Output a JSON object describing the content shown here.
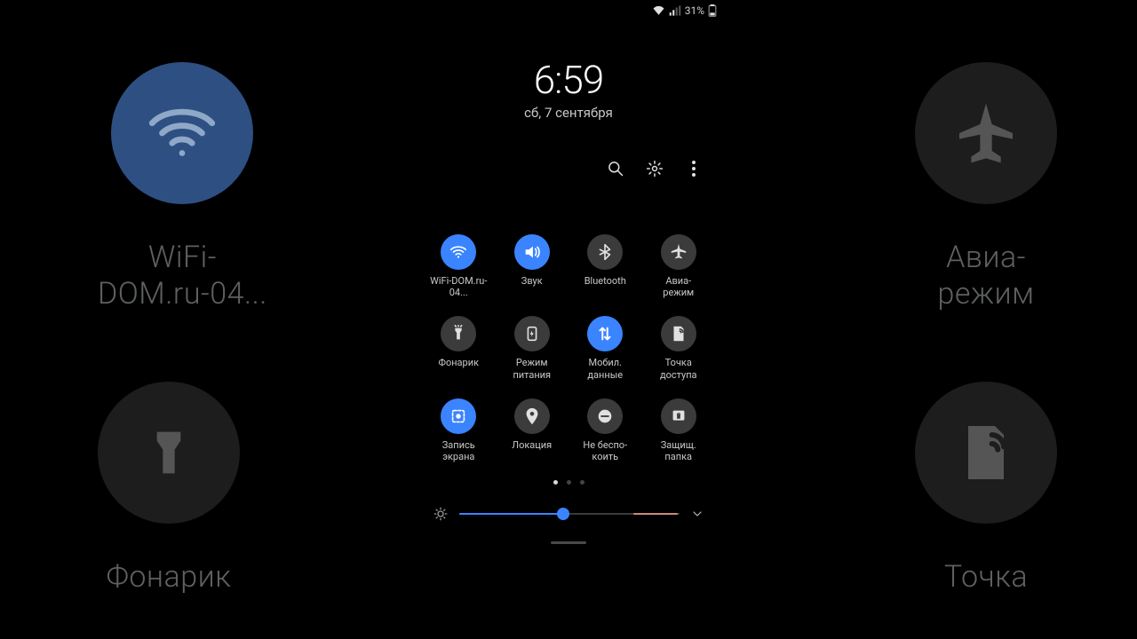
{
  "status": {
    "battery_pct": "31%"
  },
  "clock": {
    "time": "6:59",
    "date": "сб, 7 сентября"
  },
  "toggles": [
    {
      "id": "wifi",
      "label": "WiFi-DOM.ru-04...",
      "on": true
    },
    {
      "id": "sound",
      "label": "Звук",
      "on": true
    },
    {
      "id": "bluetooth",
      "label": "Bluetooth",
      "on": false
    },
    {
      "id": "airplane",
      "label": "Авиа-\nрежим",
      "on": false
    },
    {
      "id": "flashlight",
      "label": "Фонарик",
      "on": false
    },
    {
      "id": "power",
      "label": "Режим\nпитания",
      "on": false
    },
    {
      "id": "data",
      "label": "Мобил.\nданные",
      "on": true
    },
    {
      "id": "hotspot",
      "label": "Точка\nдоступа",
      "on": false
    },
    {
      "id": "record",
      "label": "Запись\nэкрана",
      "on": true
    },
    {
      "id": "location",
      "label": "Локация",
      "on": false
    },
    {
      "id": "dnd",
      "label": "Не беспо-\nкоить",
      "on": false
    },
    {
      "id": "secure",
      "label": "Защищ.\nпапка",
      "on": false
    }
  ],
  "pager": {
    "pages": 3,
    "current": 0
  },
  "brightness": {
    "value": 0.47
  },
  "bg_tiles": {
    "wifi": "WiFi-\nDOM.ru-04...",
    "airplane": "Авиа-\nрежим",
    "flashlight": "Фонарик",
    "hotspot": "Точка"
  }
}
